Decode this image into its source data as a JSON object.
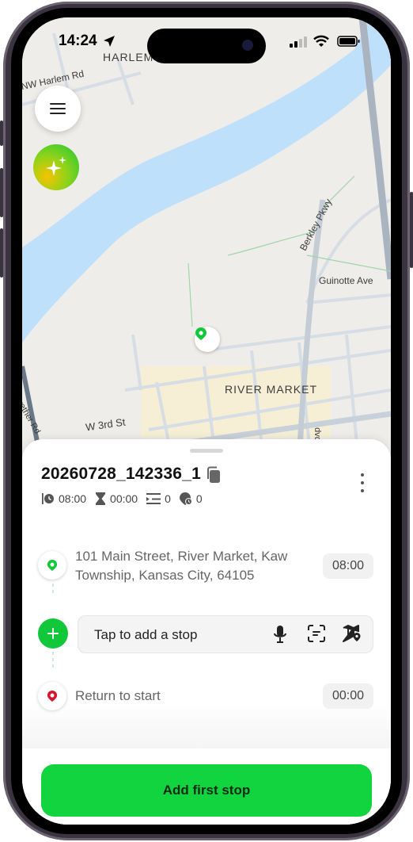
{
  "status_bar": {
    "time": "14:24",
    "icons": [
      "location-arrow-icon",
      "signal-icon",
      "wifi-icon",
      "battery-icon"
    ]
  },
  "map": {
    "labels": {
      "harlem": "HARLEM",
      "nw_harlem_rd": "NW Harlem Rd",
      "berkley_pkwy": "Berkley Pkwy",
      "guinotte_ave": "Guinotte Ave",
      "river_market": "RIVER MARKET",
      "w_3rd_st": "W 3rd St",
      "wether_rd": "wether Rd",
      "blvd_fragment": "dvd"
    },
    "colors": {
      "water": "#bfe0fb",
      "land": "#efedea",
      "road": "#d7dde5",
      "highway": "#a9b4c0",
      "market_area": "#f6efd6"
    }
  },
  "controls": {
    "menu_icon": "hamburger-menu-icon",
    "ai_icon": "sparkles-icon"
  },
  "route": {
    "title": "20260728_142336_1",
    "stats": {
      "start_time": "08:00",
      "duration": "00:00",
      "stops": "0",
      "pending": "0"
    }
  },
  "stops": {
    "start_address": "101 Main Street, River Market, Kaw Township, Kansas City, 64105",
    "start_time": "08:00",
    "add_placeholder": "Tap to add a stop",
    "return_label": "Return to start",
    "return_time": "00:00"
  },
  "cta": {
    "label": "Add first stop"
  },
  "accent_color": "#12d43f"
}
